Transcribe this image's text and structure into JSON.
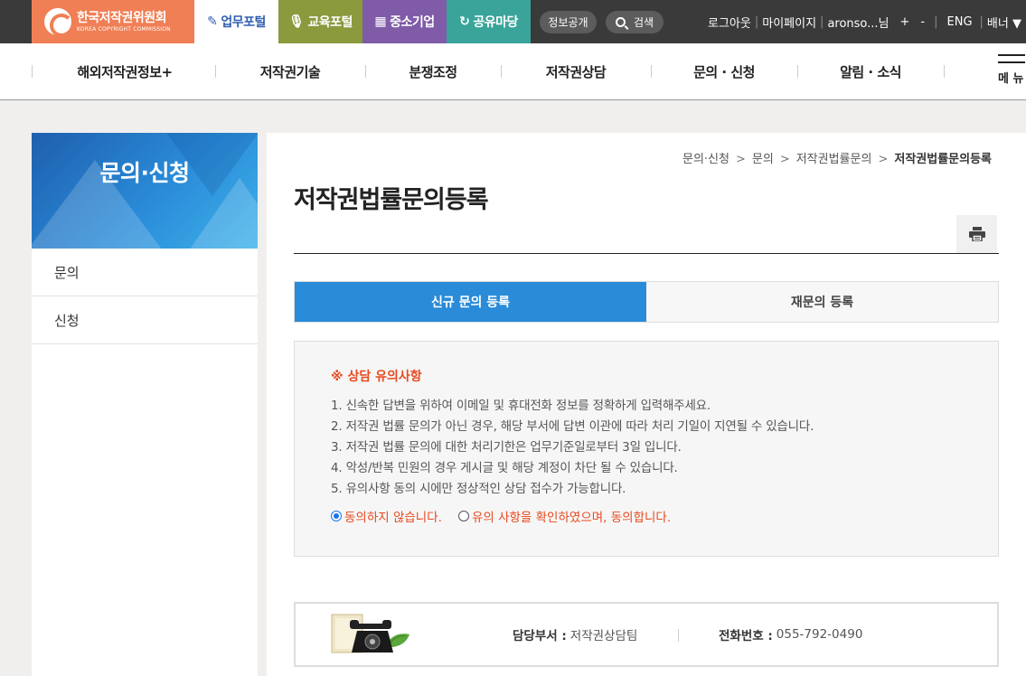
{
  "brand": {
    "name_kr": "한국저작권위원회",
    "name_en": "KOREA COPYRIGHT COMMISSION",
    "color": "#f07f55"
  },
  "portals": [
    {
      "label": "업무포털",
      "icon": "pencil-icon",
      "color": "#ffffff"
    },
    {
      "label": "교육포털",
      "icon": "microphone-icon",
      "color": "#8a9a3d"
    },
    {
      "label": "중소기업",
      "icon": "building-icon",
      "color": "#7f5ba8"
    },
    {
      "label": "공유마당",
      "icon": "share-icon",
      "color": "#3aa49a"
    }
  ],
  "topbar": {
    "info_label": "정보공개",
    "search_label": "검색",
    "logout": "로그아웃",
    "mypage": "마이페이지",
    "user": "aronso...님",
    "zoom_in": "+",
    "zoom_out": "-",
    "lang": "ENG",
    "banner": "배너"
  },
  "gnb": {
    "items": [
      "해외저작권정보+",
      "저작권기술",
      "분쟁조정",
      "저작권상담",
      "문의 · 신청",
      "알림 · 소식"
    ],
    "menu_label": "메 뉴"
  },
  "sidebar": {
    "title": "문의·신청",
    "items": [
      {
        "label": "문의"
      },
      {
        "label": "신청"
      }
    ]
  },
  "breadcrumb": [
    "문의·신청",
    "문의",
    "저작권법률문의",
    "저작권법률문의등록"
  ],
  "page": {
    "title": "저작권법률문의등록"
  },
  "tabs": [
    {
      "label": "신규 문의 등록",
      "active": true
    },
    {
      "label": "재문의 등록",
      "active": false
    }
  ],
  "notice": {
    "title": "※ 상담 유의사항",
    "lines": [
      "1. 신속한 답변을 위하여 이메일 및 휴대전화 정보를 정확하게 입력해주세요.",
      "2. 저작권 법률 문의가 아닌 경우, 해당 부서에 답변 이관에 따라 처리 기일이 지연될 수 있습니다.",
      "3. 저작권 법률 문의에 대한 처리기한은 업무기준일로부터 3일 입니다.",
      "4. 악성/반복 민원의 경우 게시글 및 해당 계정이 차단 될 수 있습니다.",
      "5. 유의사항 동의 시에만 정상적인 상담 접수가 가능합니다."
    ],
    "options": [
      {
        "label": "동의하지 않습니다.",
        "checked": true
      },
      {
        "label": "유의 사항을 확인하였으며, 동의합니다.",
        "checked": false
      }
    ]
  },
  "contact": {
    "dept_label": "담당부서 :",
    "dept_value": "저작권상담팀",
    "phone_label": "전화번호 :",
    "phone_value": "055-792-0490"
  }
}
